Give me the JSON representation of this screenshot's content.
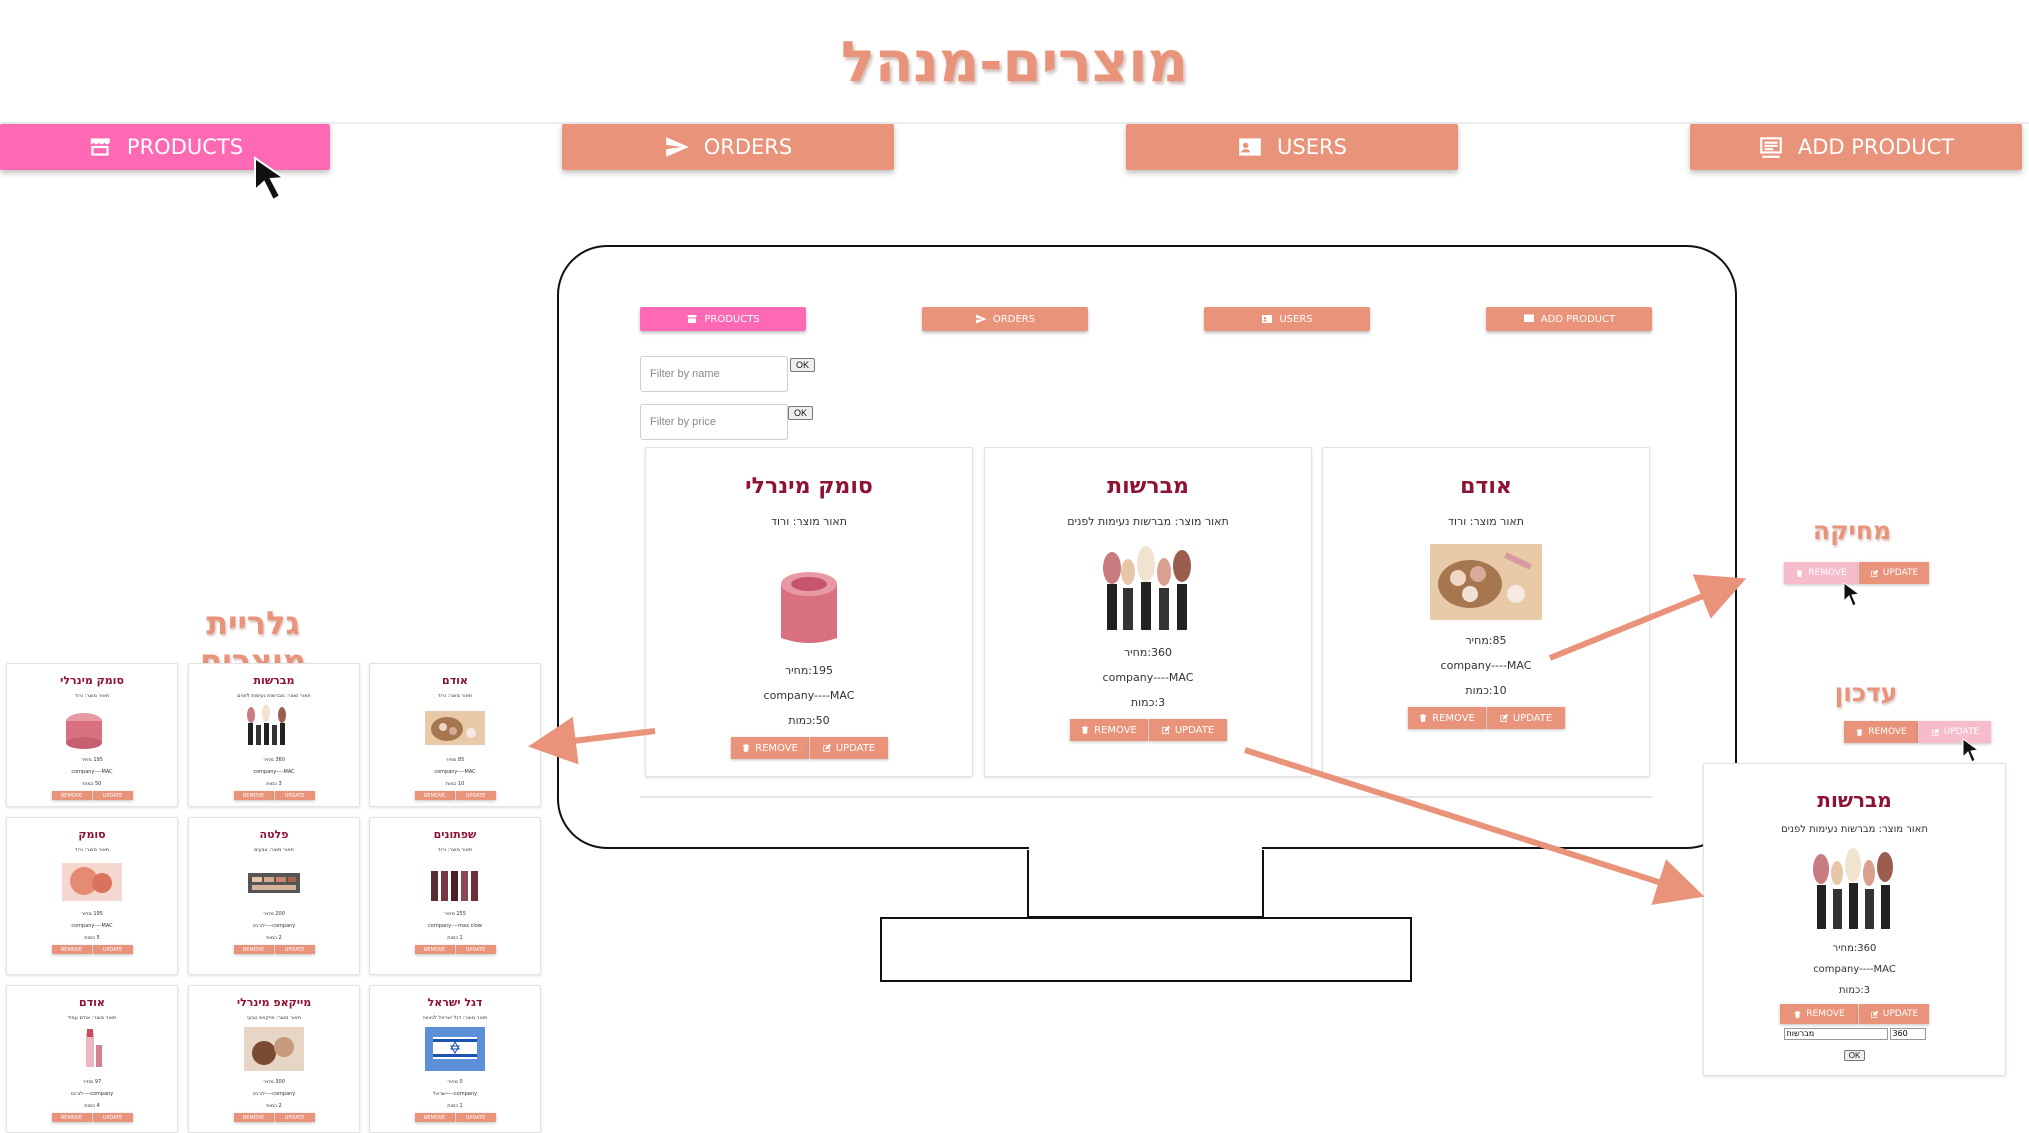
{
  "page_title": "מוצרים-מנהל",
  "nav": {
    "products": "PRODUCTS",
    "orders": "ORDERS",
    "users": "USERS",
    "add_product": "ADD PRODUCT"
  },
  "filters": {
    "name_placeholder": "Filter by name",
    "price_placeholder": "Filter by price",
    "ok": "OK"
  },
  "buttons": {
    "remove": "REMOVE",
    "update": "UPDATE"
  },
  "monitor_cards": [
    {
      "title": "סומק מינרלי",
      "desc": "תאור מוצר: ורוד",
      "price": "195:מחיר",
      "company": "company----MAC",
      "qty": "50:כמות"
    },
    {
      "title": "מברשות",
      "desc": "תאור מוצר: מברשות נעימות לפנים",
      "price": "360:מחיר",
      "company": "company----MAC",
      "qty": "3:כמות"
    },
    {
      "title": "אודם",
      "desc": "תאור מוצר: ורוד",
      "price": "85:מחיר",
      "company": "company----MAC",
      "qty": "10:כמות"
    }
  ],
  "gallery": {
    "label": "גלריית מוצרים",
    "cards": [
      {
        "title": "סומק מינרלי",
        "l1": "תאור מוצר: ורוד",
        "l2": "195 מחיר",
        "l3": "company----MAC",
        "l4": "50 כמות"
      },
      {
        "title": "מברשות",
        "l1": "תאור מוצר: מברשות נעימות לפנים",
        "l2": "360 מחיר",
        "l3": "company----MAC",
        "l4": "3 כמות"
      },
      {
        "title": "אודם",
        "l1": "תאור מוצר: ורוד",
        "l2": "85 מחיר",
        "l3": "company----MAC",
        "l4": "10 כמות"
      },
      {
        "title": "סומק",
        "l1": "תאור מוצר: ורוד",
        "l2": "195 מחיר",
        "l3": "company----MAC",
        "l4": "5 כמות"
      },
      {
        "title": "פלטה",
        "l1": "תאור מוצר: צבעים",
        "l2": "200 מחיר",
        "l3": "company----לורנס",
        "l4": "2 כמות"
      },
      {
        "title": "שפתונים",
        "l1": "תאור מוצר: ורוד",
        "l2": "255 מחיר",
        "l3": "company----max clow",
        "l4": "1 כמות"
      },
      {
        "title": "אודם",
        "l1": "תאור מוצר: אודם עמיד",
        "l2": "97 מחיר",
        "l3": "company----לורנס",
        "l4": "4 כמות"
      },
      {
        "title": "מייקאפ מינרלי",
        "l1": "תאור מוצר: מייקאפ טבעי",
        "l2": "300 מחיר",
        "l3": "company----לורנס",
        "l4": "2 כמות"
      },
      {
        "title": "דגל ישראל",
        "l1": "תאור מוצר: דגל ישראל לגאווה",
        "l2": "0 מחיר",
        "l3": "company----ישראל",
        "l4": "1 כמות"
      }
    ]
  },
  "delete_demo": {
    "label": "מחיקה"
  },
  "update_demo": {
    "label": "עדכון"
  },
  "edit_card": {
    "title": "מברשות",
    "desc": "תאור מוצר: מברשות נעימות לפנים",
    "price": "360:מחיר",
    "company": "company----MAC",
    "qty": "3:כמות",
    "name_value": "מברשות",
    "price_value": "360"
  },
  "colors": {
    "accent": "#e9937a",
    "active": "#ff69b4",
    "title_red": "#8e1232"
  }
}
